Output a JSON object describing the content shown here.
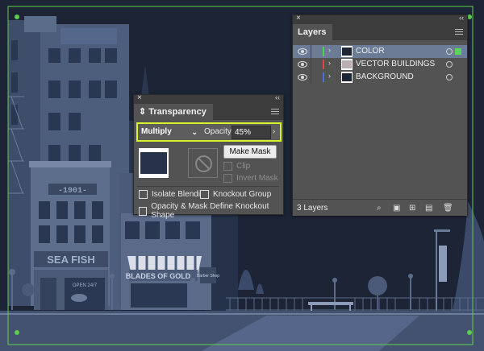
{
  "artwork": {
    "shop_signs": [
      "-1901-",
      "SEA FISH",
      "OPEN 24/7",
      "BLADES OF GOLD",
      "Barber Shop"
    ],
    "colors": {
      "background": "#1c2436",
      "building_light": "#5b6c8a",
      "building_mid": "#3e4e6a",
      "building_dark": "#2e3b55",
      "artboard_guides": "#5ccf4a"
    }
  },
  "transparency": {
    "title": "Transparency",
    "blend_mode": "Multiply",
    "opacity_label": "Opacity:",
    "opacity_value": "45%",
    "make_mask_label": "Make Mask",
    "clip_label": "Clip",
    "invert_mask_label": "Invert Mask",
    "isolate_blending_label": "Isolate Blending",
    "knockout_group_label": "Knockout Group",
    "opacity_mask_label": "Opacity & Mask Define Knockout Shape",
    "highlight_color": "#d7f42a"
  },
  "layers": {
    "title": "Layers",
    "items": [
      {
        "name": "COLOR",
        "color": "#4ad44a",
        "selected": true
      },
      {
        "name": "VECTOR BUILDINGS",
        "color": "#e04545",
        "selected": false
      },
      {
        "name": "BACKGROUND",
        "color": "#4a6ee0",
        "selected": false
      }
    ],
    "count_label": "3 Layers"
  }
}
